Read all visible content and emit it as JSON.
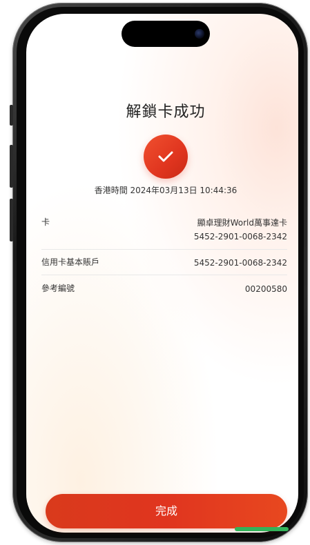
{
  "page": {
    "title": "解鎖卡成功",
    "timestamp": "香港時間 2024年03月13日 10:44:36"
  },
  "details": {
    "card": {
      "label": "卡",
      "name": "顯卓理財World萬事達卡",
      "number": "5452-2901-0068-2342"
    },
    "credit_account": {
      "label": "信用卡基本賬戶",
      "value": "5452-2901-0068-2342"
    },
    "reference": {
      "label": "參考編號",
      "value": "00200580"
    }
  },
  "actions": {
    "done_label": "完成"
  },
  "colors": {
    "accent": "#e0351f",
    "text": "#333333"
  },
  "icons": {
    "success": "check-circle-icon"
  }
}
